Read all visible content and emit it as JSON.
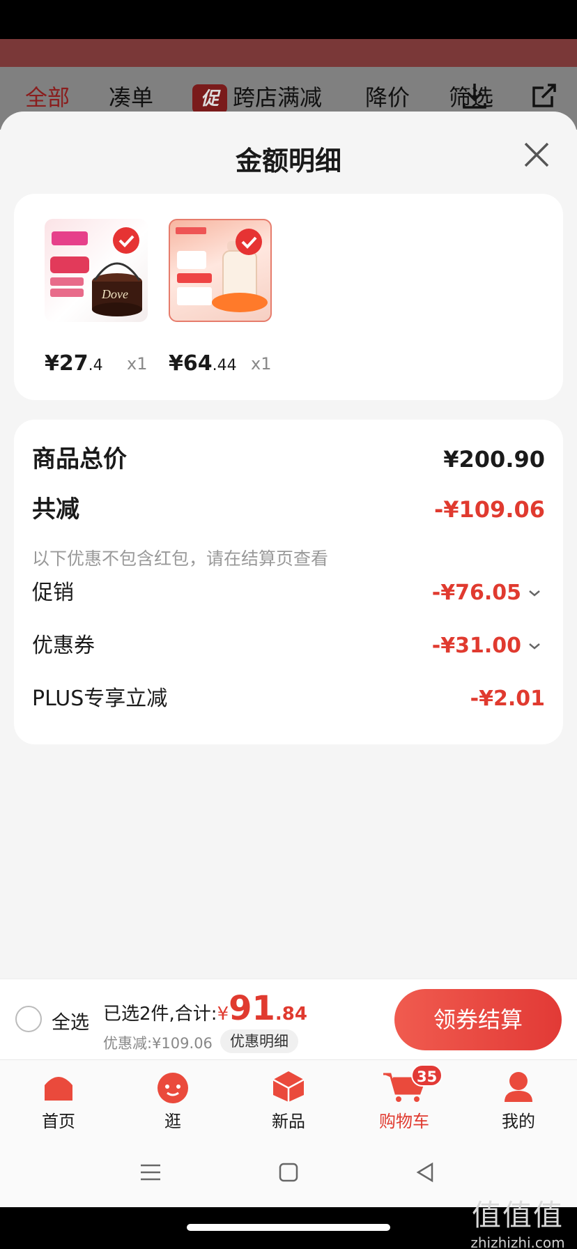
{
  "filter_bar": {
    "items": [
      "全部",
      "凑单",
      "跨店满减",
      "降价",
      "筛选"
    ],
    "promo_tag": "促"
  },
  "sheet": {
    "title": "金额明细"
  },
  "products": [
    {
      "price_int": "¥27",
      "price_dec": ".4",
      "qty": "x1",
      "image": "Dove chocolate tub with 11.11 promo ¥31.9"
    },
    {
      "price_int": "¥64",
      "price_dec": ".44",
      "qty": "x1",
      "image": "Pigeon baby bottle with promo 93"
    }
  ],
  "detail": {
    "total_label": "商品总价",
    "total_value": "¥200.90",
    "reduce_label": "共减",
    "reduce_value": "-¥109.06",
    "note": "以下优惠不包含红包，请在结算页查看",
    "promo_label": "促销",
    "promo_value": "-¥76.05",
    "coupon_label": "优惠券",
    "coupon_value": "-¥31.00",
    "plus_label": "PLUS专享立减",
    "plus_value": "-¥2.01"
  },
  "checkout": {
    "select_all": "全选",
    "summary_prefix": "已选2件,合计:",
    "yen": "¥",
    "amount_int": "91",
    "amount_dec": ".84",
    "discount": "优惠减:¥109.06",
    "detail_pill": "优惠明细",
    "pay_button": "领券结算"
  },
  "tabbar": {
    "items": [
      "首页",
      "逛",
      "新品",
      "购物车",
      "我的"
    ],
    "cart_badge": "35",
    "active_color": "#e03a2f"
  },
  "watermark": {
    "line1": "值值值",
    "line2": "zhizhizhi.com"
  },
  "colors": {
    "accent": "#e03a2f",
    "button": "#e23a36"
  }
}
